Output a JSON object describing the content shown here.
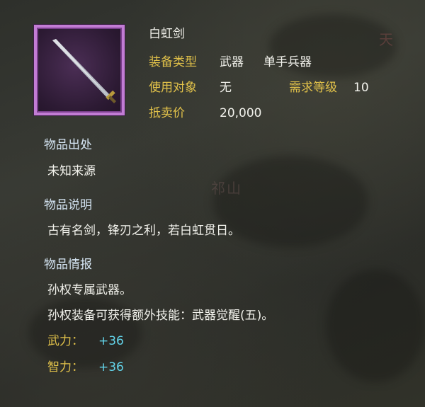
{
  "item": {
    "name": "白虹剑",
    "icon": "sword-icon",
    "frame_color": "#c27cd4"
  },
  "stats": {
    "equip_type_label": "装备类型",
    "equip_type_value": "武器",
    "equip_subtype_value": "单手兵器",
    "target_label": "使用对象",
    "target_value": "无",
    "level_label": "需求等级",
    "level_value": "10",
    "price_label": "抵卖价",
    "price_value": "20,000"
  },
  "sections": {
    "origin_heading": "物品出处",
    "origin_text": "未知来源",
    "desc_heading": "物品说明",
    "desc_text": "古有名剑，锋刃之利，若白虹贯日。",
    "info_heading": "物品情报",
    "info_line1": "孙权专属武器。",
    "info_line2": "孙权装备可获得额外技能：武器觉醒(五)。"
  },
  "bonuses": [
    {
      "label": "武力：",
      "value": "+36"
    },
    {
      "label": "智力：",
      "value": "+36"
    }
  ],
  "background_map_labels": {
    "top_right": "天",
    "mid": "祁山"
  },
  "colors": {
    "label_gold": "#e2c24a",
    "text_white": "#f2f2ec",
    "bonus_blue": "#63d4ea",
    "heading_blue_white": "#d6e6f4"
  }
}
